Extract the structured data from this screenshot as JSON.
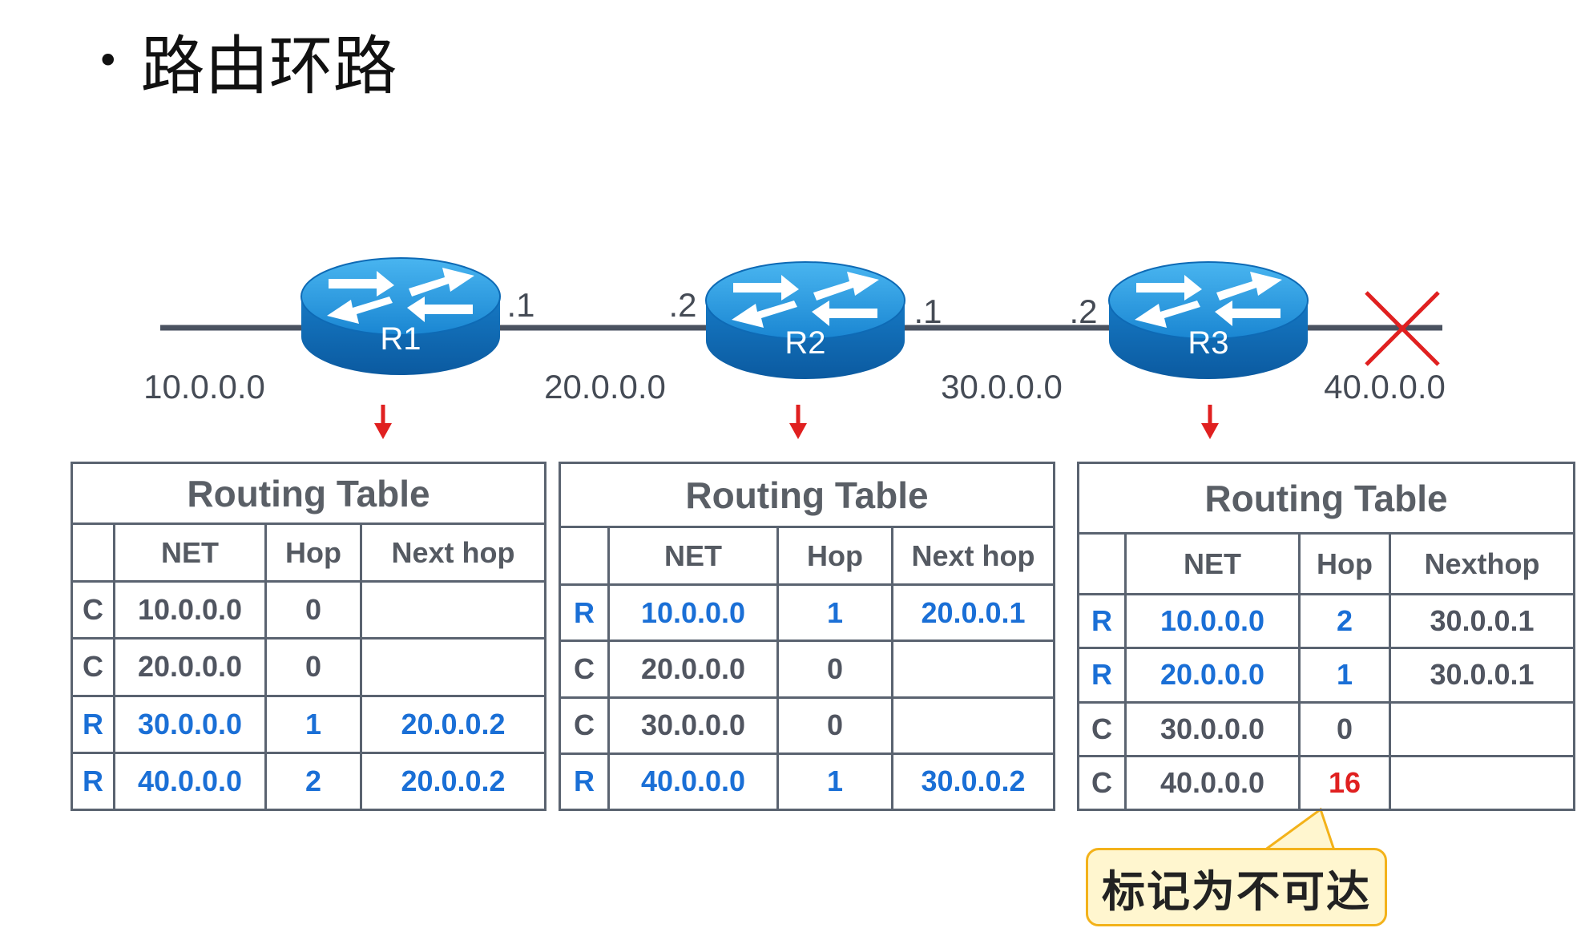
{
  "title": "路由环路",
  "networks": [
    "10.0.0.0",
    "20.0.0.0",
    "30.0.0.0",
    "40.0.0.0"
  ],
  "routers": [
    {
      "name": "R1",
      "left_if": "",
      "right_if": ".1"
    },
    {
      "name": "R2",
      "left_if": ".2",
      "right_if": ".1"
    },
    {
      "name": "R3",
      "left_if": ".2",
      "right_if": ""
    }
  ],
  "tables": [
    {
      "caption": "Routing Table",
      "headers": [
        "",
        "NET",
        "Hop",
        "Next hop"
      ],
      "rows": [
        {
          "type": "C",
          "net": "10.0.0.0",
          "hop": "0",
          "next": "",
          "style": "normal"
        },
        {
          "type": "C",
          "net": "20.0.0.0",
          "hop": "0",
          "next": "",
          "style": "normal"
        },
        {
          "type": "R",
          "net": "30.0.0.0",
          "hop": "1",
          "next": "20.0.0.2",
          "style": "blue"
        },
        {
          "type": "R",
          "net": "40.0.0.0",
          "hop": "2",
          "next": "20.0.0.2",
          "style": "blue"
        }
      ]
    },
    {
      "caption": "Routing Table",
      "headers": [
        "",
        "NET",
        "Hop",
        "Next hop"
      ],
      "rows": [
        {
          "type": "R",
          "net": "10.0.0.0",
          "hop": "1",
          "next": "20.0.0.1",
          "style": "blue"
        },
        {
          "type": "C",
          "net": "20.0.0.0",
          "hop": "0",
          "next": "",
          "style": "normal"
        },
        {
          "type": "C",
          "net": "30.0.0.0",
          "hop": "0",
          "next": "",
          "style": "normal"
        },
        {
          "type": "R",
          "net": "40.0.0.0",
          "hop": "1",
          "next": "30.0.0.2",
          "style": "blue"
        }
      ]
    },
    {
      "caption": "Routing Table",
      "headers": [
        "",
        "NET",
        "Hop",
        "Nexthop"
      ],
      "rows": [
        {
          "type": "R",
          "net": "10.0.0.0",
          "hop": "2",
          "next": "30.0.0.1",
          "style": "blue-next-gray"
        },
        {
          "type": "R",
          "net": "20.0.0.0",
          "hop": "1",
          "next": "30.0.0.1",
          "style": "blue-next-gray"
        },
        {
          "type": "C",
          "net": "30.0.0.0",
          "hop": "0",
          "next": "",
          "style": "normal"
        },
        {
          "type": "C",
          "net": "40.0.0.0",
          "hop": "16",
          "next": "",
          "style": "hop-red"
        }
      ]
    }
  ],
  "callout": "标记为不可达",
  "colors": {
    "blue": "#1a6fd6",
    "red": "#e02020",
    "line": "#4a5260",
    "router": "#1d8fd8"
  }
}
